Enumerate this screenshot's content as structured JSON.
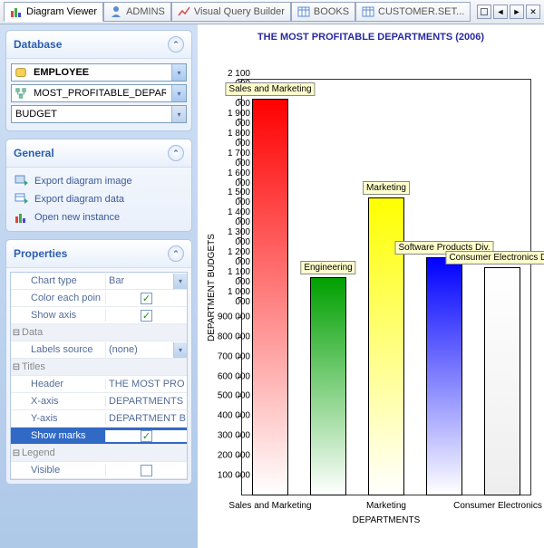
{
  "tabs": [
    {
      "label": "Diagram Viewer",
      "active": true,
      "icon": "chart-bar-icon"
    },
    {
      "label": "ADMINS",
      "active": false,
      "icon": "person-blue-icon"
    },
    {
      "label": "Visual Query Builder",
      "active": false,
      "icon": "chart-line-icon"
    },
    {
      "label": "BOOKS",
      "active": false,
      "icon": "table-icon"
    },
    {
      "label": "CUSTOMER.SET...",
      "active": false,
      "icon": "table-icon"
    }
  ],
  "sidebar": {
    "database": {
      "title": "Database",
      "db_name": "EMPLOYEE",
      "object": "MOST_PROFITABLE_DEPARTME",
      "value_field": "BUDGET"
    },
    "general": {
      "title": "General",
      "items": [
        {
          "label": "Export diagram image",
          "icon": "export-image-icon"
        },
        {
          "label": "Export diagram data",
          "icon": "export-data-icon"
        },
        {
          "label": "Open new instance",
          "icon": "new-instance-icon"
        }
      ]
    },
    "properties": {
      "title": "Properties",
      "rows": {
        "chart_type": {
          "label": "Chart type",
          "value": "Bar"
        },
        "color_each": {
          "label": "Color each poin",
          "checked": true
        },
        "show_axis": {
          "label": "Show axis",
          "checked": true
        },
        "cat_data": "Data",
        "labels_source": {
          "label": "Labels source",
          "value": "(none)"
        },
        "cat_titles": "Titles",
        "header": {
          "label": "Header",
          "value": "THE MOST PRO"
        },
        "x_axis": {
          "label": "X-axis",
          "value": "DEPARTMENTS"
        },
        "y_axis": {
          "label": "Y-axis",
          "value": "DEPARTMENT B"
        },
        "show_marks": {
          "label": "Show marks",
          "checked": true
        },
        "cat_legend": "Legend",
        "visible": {
          "label": "Visible",
          "checked": false
        }
      }
    }
  },
  "chart_data": {
    "type": "bar",
    "title": "THE MOST PROFITABLE DEPARTMENTS (2006)",
    "xlabel": "DEPARTMENTS",
    "ylabel": "DEPARTMENT BUDGETS",
    "ylim": [
      0,
      2100000
    ],
    "ytick_interval": 100000,
    "categories": [
      "Sales and Marketing",
      "Engineering",
      "Marketing",
      "Software Products Div.",
      "Consumer Electronics Div."
    ],
    "values": [
      2000000,
      1100000,
      1500000,
      1200000,
      1150000
    ],
    "x_tick_labels": [
      "Sales and Marketing",
      "Marketing",
      "Consumer Electronics D"
    ],
    "colors": [
      "#ff0000",
      "#00a000",
      "#ffff00",
      "#0000ff",
      "#ffffff"
    ]
  }
}
